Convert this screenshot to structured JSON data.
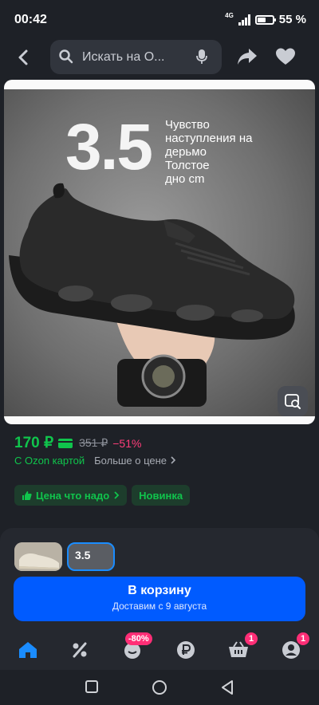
{
  "status": {
    "time": "00:42",
    "network": "4G",
    "battery": "55 %",
    "battery_level": 0.55
  },
  "search": {
    "placeholder": "Искать на O..."
  },
  "product": {
    "badge_number": "3.5",
    "promo_text": "Чувство\nнаступления на\nдерьмо\nТолстое\nдно cm"
  },
  "price": {
    "current": "170 ₽",
    "old": "351 ₽",
    "discount": "−51%",
    "with_card": "С Ozon картой",
    "more_about_price": "Больше о цене"
  },
  "tags": [
    {
      "label": "Цена что надо",
      "icon": "thumbs-up-icon"
    },
    {
      "label": "Новинка"
    }
  ],
  "variants": [
    {
      "label": ""
    },
    {
      "label": "3.5"
    }
  ],
  "cart": {
    "label": "В корзину",
    "delivery": "Доставим с 9 августа"
  },
  "bottom_nav": {
    "items": [
      {
        "name": "home-icon"
      },
      {
        "name": "percent-icon"
      },
      {
        "name": "fresh-icon",
        "badge": "-80%"
      },
      {
        "name": "ruble-icon"
      },
      {
        "name": "cart-icon",
        "badge": "1"
      },
      {
        "name": "profile-icon",
        "badge": "1"
      }
    ]
  },
  "colors": {
    "accent": "#005bff",
    "green": "#10c44c",
    "pink": "#ff2e76",
    "active_nav": "#1a8cff"
  }
}
